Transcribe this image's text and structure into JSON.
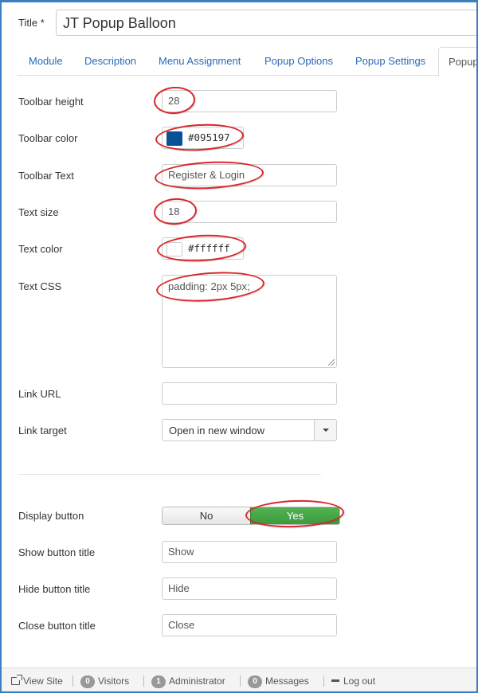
{
  "title": {
    "label": "Title *",
    "value": "JT Popup Balloon"
  },
  "tabs": [
    {
      "label": "Module"
    },
    {
      "label": "Description"
    },
    {
      "label": "Menu Assignment"
    },
    {
      "label": "Popup Options"
    },
    {
      "label": "Popup Settings"
    },
    {
      "label": "Popup"
    }
  ],
  "fields": {
    "toolbar_height": {
      "label": "Toolbar height",
      "value": "28"
    },
    "toolbar_color": {
      "label": "Toolbar color",
      "value": "#095197",
      "swatch": "#095197"
    },
    "toolbar_text": {
      "label": "Toolbar Text",
      "value": "Register & Login"
    },
    "text_size": {
      "label": "Text size",
      "value": "18"
    },
    "text_color": {
      "label": "Text color",
      "value": "#ffffff",
      "swatch": "#ffffff"
    },
    "text_css": {
      "label": "Text CSS",
      "value": "padding: 2px 5px;"
    },
    "link_url": {
      "label": "Link URL",
      "value": ""
    },
    "link_target": {
      "label": "Link target",
      "value": "Open in new window"
    },
    "display_button": {
      "label": "Display button",
      "options": [
        "No",
        "Yes"
      ],
      "selected": "Yes"
    },
    "show_button_title": {
      "label": "Show button title",
      "value": "Show"
    },
    "hide_button_title": {
      "label": "Hide button title",
      "value": "Hide"
    },
    "close_button_title": {
      "label": "Close button title",
      "value": "Close"
    }
  },
  "statusbar": {
    "view_site": "View Site",
    "visitors_count": "0",
    "visitors_label": "Visitors",
    "admin_count": "1",
    "admin_label": "Administrator",
    "messages_count": "0",
    "messages_label": "Messages",
    "logout": "Log out"
  },
  "colors": {
    "accent": "#2a69b8",
    "toggle_yes": "#46a546",
    "annotation": "#d9262c",
    "frame": "#3c7fbf"
  }
}
